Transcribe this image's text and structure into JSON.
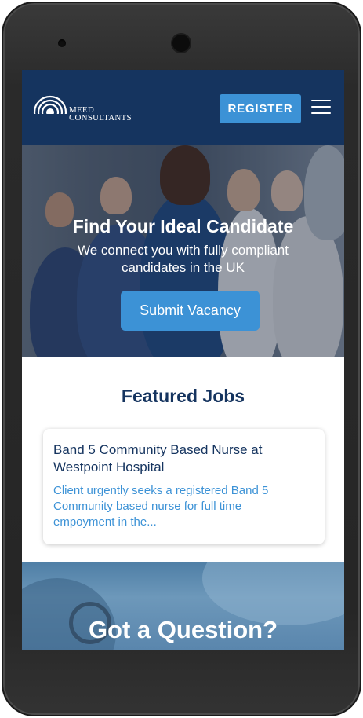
{
  "header": {
    "logo_line1": "MEED",
    "logo_line2": "CONSULTANTS",
    "register_label": "REGISTER",
    "menu_icon": "hamburger-menu-icon"
  },
  "hero": {
    "title": "Find Your Ideal Candidate",
    "subtitle": "We connect you with fully compliant candidates in the UK",
    "cta_label": "Submit Vacancy"
  },
  "featured": {
    "title": "Featured Jobs",
    "jobs": [
      {
        "title": "Band 5 Community Based Nurse at Westpoint Hospital",
        "description": "Client urgently seeks a registered Band 5 Community based nurse for full time empoyment in the..."
      }
    ]
  },
  "question": {
    "title": "Got a Question?"
  },
  "colors": {
    "header_bg": "#15345f",
    "accent": "#3c92d6",
    "heading": "#15345f"
  }
}
